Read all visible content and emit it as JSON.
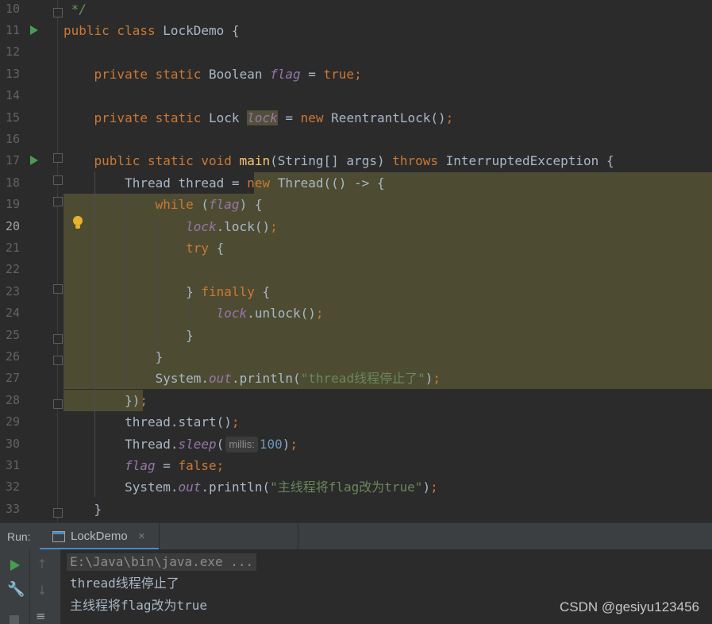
{
  "editor": {
    "lines": [
      {
        "n": "10",
        "html": "<span class=\"cm\"> */</span>"
      },
      {
        "n": "11",
        "html": "<span class=\"kw\">public class </span>LockDemo {"
      },
      {
        "n": "12",
        "html": ""
      },
      {
        "n": "13",
        "html": "    <span class=\"kw\">private static </span>Boolean <span class=\"fld\">flag</span> = <span class=\"kw\">true</span><span class=\"smi\">;</span>"
      },
      {
        "n": "14",
        "html": ""
      },
      {
        "n": "15",
        "html": "    <span class=\"kw\">private static </span>Lock <span class=\"fld lockbox\">lock</span> = <span class=\"kw\">new </span>ReentrantLock()<span class=\"smi\">;</span>"
      },
      {
        "n": "16",
        "html": ""
      },
      {
        "n": "17",
        "html": "    <span class=\"kw\">public static void </span><span class=\"fn\">main</span>(String[] args) <span class=\"kw\">throws </span>InterruptedException {"
      },
      {
        "n": "18",
        "html": "        Thread thread = <span class=\"kw\">new </span>Thread(() -> {"
      },
      {
        "n": "19",
        "html": "            <span class=\"kw\">while </span>(<span class=\"fld\">flag</span>) {"
      },
      {
        "n": "20",
        "html": "                <span class=\"fld\">lock</span>.lock()<span class=\"smi\">;</span>"
      },
      {
        "n": "21",
        "html": "                <span class=\"kw\">try </span>{"
      },
      {
        "n": "22",
        "html": ""
      },
      {
        "n": "23",
        "html": "                } <span class=\"kw\">finally </span>{"
      },
      {
        "n": "24",
        "html": "                    <span class=\"fld\">lock</span>.unlock()<span class=\"smi\">;</span>"
      },
      {
        "n": "25",
        "html": "                }"
      },
      {
        "n": "26",
        "html": "            }"
      },
      {
        "n": "27",
        "html": "            System.<span class=\"fld\">out</span>.println(<span class=\"st\">\"thread线程停止了\"</span>)<span class=\"smi\">;</span>"
      },
      {
        "n": "28",
        "html": "        })<span class=\"smi\">;</span>"
      },
      {
        "n": "29",
        "html": "        thread.start()<span class=\"smi\">;</span>"
      },
      {
        "n": "30",
        "html": "        Thread.<span class=\"fld\">sleep</span>(<span class=\"hint\">millis:</span><span class=\"nm\">100</span>)<span class=\"smi\">;</span>"
      },
      {
        "n": "31",
        "html": "        <span class=\"fld\">flag</span> = <span class=\"kw\">false</span><span class=\"smi\">;</span>"
      },
      {
        "n": "32",
        "html": "        System.<span class=\"fld\">out</span>.println(<span class=\"st\">\"主线程将flag改为true\"</span>)<span class=\"smi\">;</span>"
      },
      {
        "n": "33",
        "html": "    }"
      }
    ]
  },
  "run_panel": {
    "label": "Run:",
    "tab_label": "LockDemo",
    "tab_close": "×",
    "console": {
      "command": "E:\\Java\\bin\\java.exe ...",
      "output": [
        "thread线程停止了",
        "主线程将flag改为true"
      ]
    }
  },
  "icons": {
    "run": "run-gutter-icon",
    "bulb": "intention-bulb-icon",
    "rerun": "rerun-icon",
    "settings": "wrench-icon",
    "stop": "stop-icon",
    "up": "arrow-up-icon",
    "down": "arrow-down-icon",
    "wrap": "soft-wrap-icon"
  },
  "watermark": "CSDN @gesiyu123456"
}
